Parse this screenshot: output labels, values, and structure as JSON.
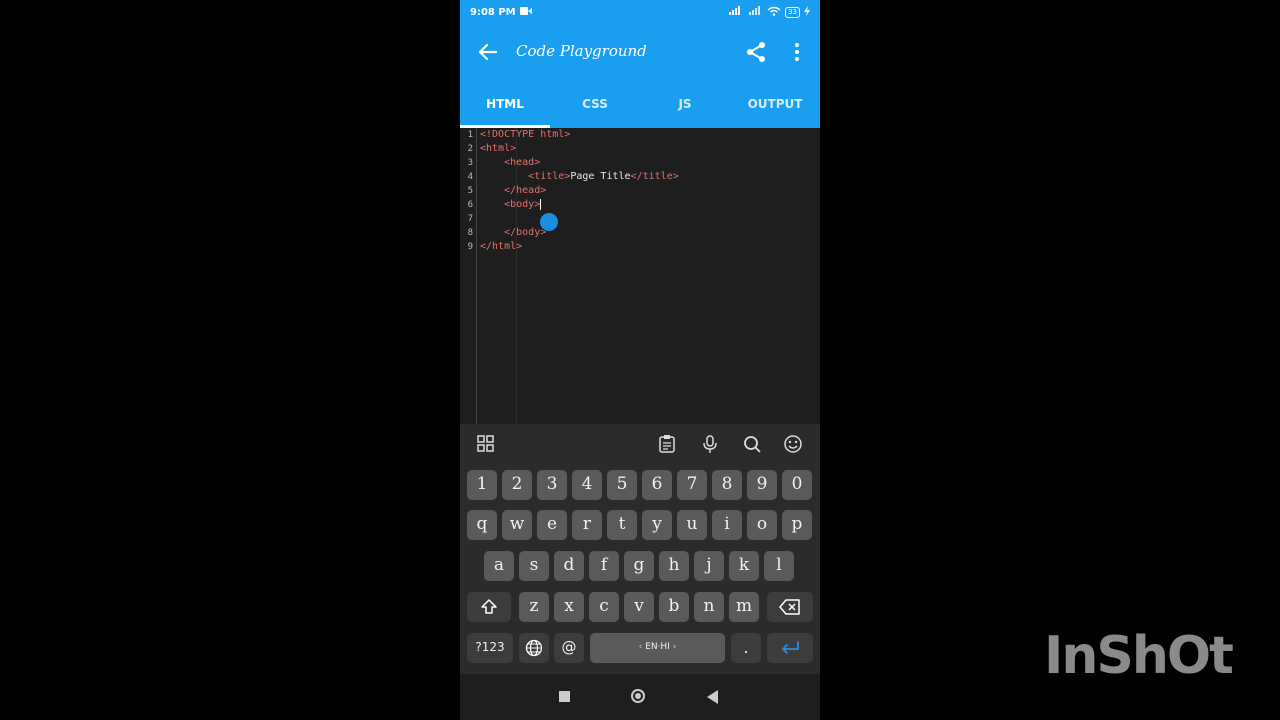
{
  "status_bar": {
    "time": "9:08 PM",
    "battery": "33"
  },
  "app_bar": {
    "title": "Code Playground"
  },
  "tabs": [
    {
      "label": "HTML",
      "active": true
    },
    {
      "label": "CSS"
    },
    {
      "label": "JS"
    },
    {
      "label": "OUTPUT"
    }
  ],
  "editor": {
    "line_numbers": [
      "1",
      "2",
      "3",
      "4",
      "5",
      "6",
      "7",
      "8",
      "9"
    ],
    "lines": {
      "l1": "<!DOCTYPE html>",
      "l2": "<html>",
      "l3": "<head>",
      "l4_open": "<title>",
      "l4_text": "Page Title",
      "l4_close": "</title>",
      "l5": "</head>",
      "l6": "<body>",
      "l8": "</body>",
      "l9": "</html>"
    }
  },
  "keyboard": {
    "numbers": [
      "1",
      "2",
      "3",
      "4",
      "5",
      "6",
      "7",
      "8",
      "9",
      "0"
    ],
    "row1": [
      "q",
      "w",
      "e",
      "r",
      "t",
      "y",
      "u",
      "i",
      "o",
      "p"
    ],
    "row2": [
      "a",
      "s",
      "d",
      "f",
      "g",
      "h",
      "j",
      "k",
      "l"
    ],
    "row3": [
      "z",
      "x",
      "c",
      "v",
      "b",
      "n",
      "m"
    ],
    "symbols_key": "?123",
    "at_key": "@",
    "space_label": "EN·HI",
    "period_key": "."
  },
  "watermark": "InShOt",
  "colors": {
    "accent": "#1a9ff0",
    "tag": "#e2716b",
    "editor_bg": "#1e1e1e"
  }
}
